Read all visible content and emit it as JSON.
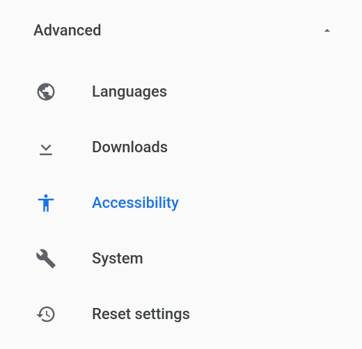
{
  "section": {
    "title": "Advanced"
  },
  "items": [
    {
      "label": "Languages",
      "icon": "globe",
      "selected": false
    },
    {
      "label": "Downloads",
      "icon": "download",
      "selected": false
    },
    {
      "label": "Accessibility",
      "icon": "accessibility",
      "selected": true
    },
    {
      "label": "System",
      "icon": "wrench",
      "selected": false
    },
    {
      "label": "Reset settings",
      "icon": "history",
      "selected": false
    }
  ],
  "colors": {
    "accent": "#1a73e8",
    "text": "#3c4043",
    "icon": "#5f6368",
    "background": "#fafafa"
  }
}
